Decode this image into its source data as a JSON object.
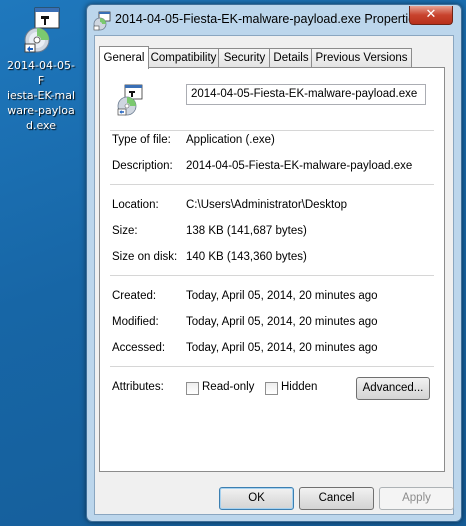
{
  "desktop": {
    "icon_label_lines": [
      "2014-04-05-F",
      "iesta-EK-mal",
      "ware-payloa",
      "d.exe"
    ]
  },
  "window": {
    "title": "2014-04-05-Fiesta-EK-malware-payload.exe Properties",
    "close_symbol": "✕",
    "tabs": [
      {
        "label": "General",
        "active": true
      },
      {
        "label": "Compatibility",
        "active": false
      },
      {
        "label": "Security",
        "active": false
      },
      {
        "label": "Details",
        "active": false
      },
      {
        "label": "Previous Versions",
        "active": false
      }
    ],
    "file_name": "2014-04-05-Fiesta-EK-malware-payload.exe",
    "fields": {
      "type_label": "Type of file:",
      "type_value": "Application (.exe)",
      "description_label": "Description:",
      "description_value": "2014-04-05-Fiesta-EK-malware-payload.exe",
      "location_label": "Location:",
      "location_value": "C:\\Users\\Administrator\\Desktop",
      "size_label": "Size:",
      "size_value": "138 KB (141,687 bytes)",
      "size_on_disk_label": "Size on disk:",
      "size_on_disk_value": "140 KB (143,360 bytes)",
      "created_label": "Created:",
      "created_value": "Today, April 05, 2014, 20 minutes ago",
      "modified_label": "Modified:",
      "modified_value": "Today, April 05, 2014, 20 minutes ago",
      "accessed_label": "Accessed:",
      "accessed_value": "Today, April 05, 2014, 20 minutes ago",
      "attributes_label": "Attributes:"
    },
    "attributes": {
      "readonly_label": "Read-only",
      "readonly_checked": false,
      "hidden_label": "Hidden",
      "hidden_checked": false,
      "advanced_label": "Advanced..."
    },
    "buttons": {
      "ok": "OK",
      "cancel": "Cancel",
      "apply": "Apply"
    }
  }
}
